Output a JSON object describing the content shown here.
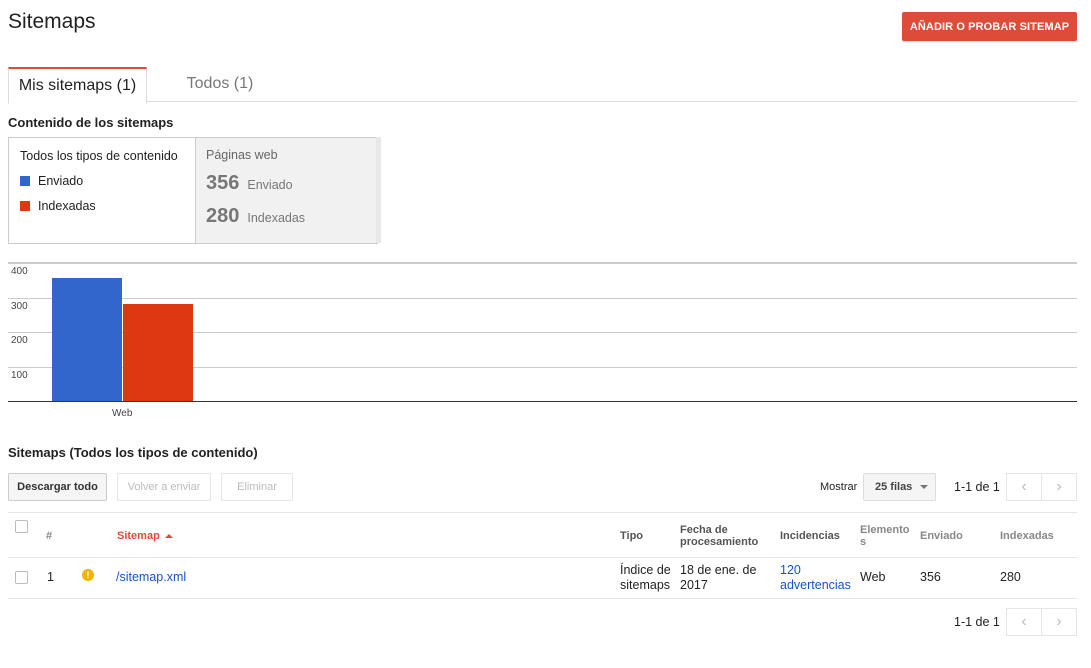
{
  "header": {
    "title": "Sitemaps",
    "add_button": "AÑADIR O PROBAR SITEMAP"
  },
  "tabs": [
    {
      "label": "Mis sitemaps (1)",
      "active": true
    },
    {
      "label": "Todos (1)",
      "active": false
    }
  ],
  "content_section": {
    "heading": "Contenido de los sitemaps",
    "legend": {
      "title": "Todos los tipos de contenido",
      "items": [
        {
          "label": "Enviado",
          "color": "#3366cc"
        },
        {
          "label": "Indexadas",
          "color": "#dc3912"
        }
      ]
    },
    "stats": {
      "title": "Páginas web",
      "rows": [
        {
          "value": "356",
          "label": "Enviado"
        },
        {
          "value": "280",
          "label": "Indexadas"
        }
      ]
    }
  },
  "chart_data": {
    "type": "bar",
    "categories": [
      "Web"
    ],
    "series": [
      {
        "name": "Enviado",
        "values": [
          356
        ],
        "color": "#3366cc"
      },
      {
        "name": "Indexadas",
        "values": [
          280
        ],
        "color": "#dc3912"
      }
    ],
    "yticks": [
      "100",
      "200",
      "300",
      "400"
    ],
    "ylim": [
      0,
      400
    ],
    "grid": true
  },
  "sitemaps_section": {
    "heading": "Sitemaps (Todos los tipos de contenido)",
    "buttons": {
      "download": "Descargar todo",
      "resend": "Volver a enviar",
      "delete": "Eliminar"
    },
    "show_label": "Mostrar",
    "rows_option": "25 filas",
    "pager_text": "1-1 de 1",
    "columns": {
      "num": "#",
      "sitemap": "Sitemap",
      "type": "Tipo",
      "date_line1": "Fecha de",
      "date_line2": "procesamiento",
      "issues": "Incidencias",
      "elements_line1": "Elemento",
      "elements_line2": "s",
      "submitted": "Enviado",
      "indexed": "Indexadas"
    },
    "rows": [
      {
        "num": "1",
        "status_icon": "warning-icon",
        "sitemap": "/sitemap.xml",
        "type_line1": "Índice de",
        "type_line2": "sitemaps",
        "date_line1": "18 de ene. de",
        "date_line2": "2017",
        "issues_line1": "120",
        "issues_line2": "advertencias",
        "elements": "Web",
        "submitted": "356",
        "indexed": "280"
      }
    ]
  }
}
